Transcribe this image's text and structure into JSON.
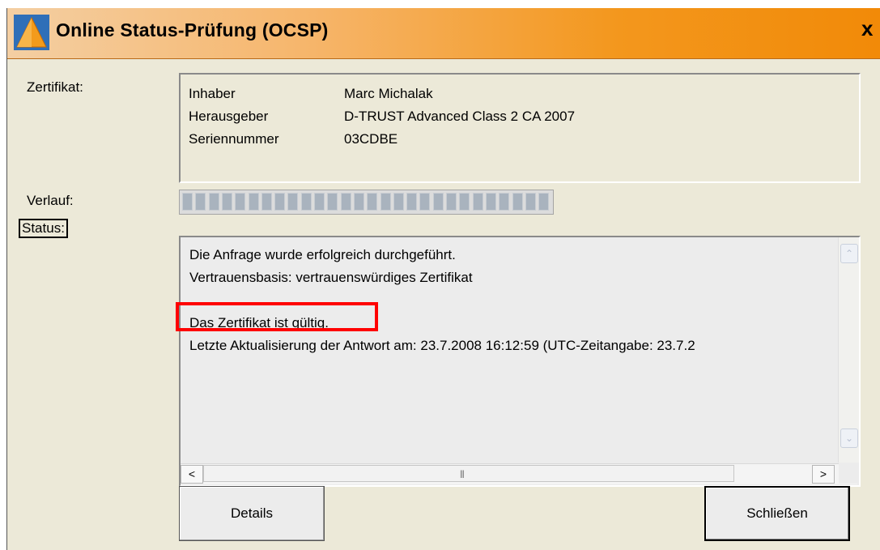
{
  "window": {
    "title": "Online Status-Prüfung (OCSP)",
    "close_glyph": "x"
  },
  "labels": {
    "certificate": "Zertifikat:",
    "progress": "Verlauf:",
    "status": "Status:"
  },
  "certificate": {
    "rows": [
      {
        "key": "Inhaber",
        "value": "Marc Michalak"
      },
      {
        "key": "Herausgeber",
        "value": "D-TRUST Advanced Class 2 CA 2007"
      },
      {
        "key": "Seriennummer",
        "value": "03CDBE"
      }
    ]
  },
  "progress": {
    "value_percent": 100
  },
  "status_text": {
    "line1": "Die Anfrage wurde erfolgreich durchgeführt.",
    "line2": "Vertrauensbasis: vertrauenswürdiges Zertifikat",
    "line3": "Das Zertifikat ist gültig.",
    "line4": "Letzte Aktualisierung der Antwort am: 23.7.2008 16:12:59 (UTC-Zeitangabe: 23.7.2"
  },
  "scrollbars": {
    "up_arrow": "⌃",
    "down_arrow": "⌄",
    "left_arrow": "<",
    "right_arrow": ">",
    "grip": "|||"
  },
  "buttons": {
    "details": "Details",
    "close": "Schließen"
  },
  "colors": {
    "title_gradient_end": "#f28a08",
    "highlight_border": "#ff0000"
  }
}
